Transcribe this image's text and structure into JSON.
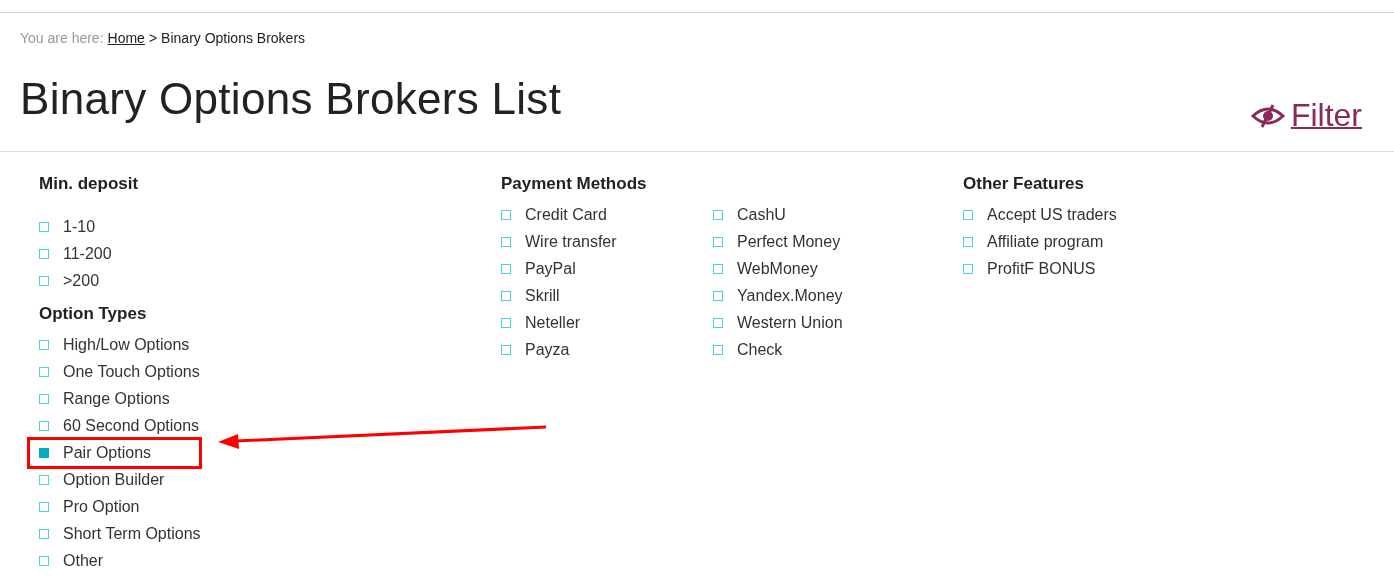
{
  "breadcrumb": {
    "prefix": "You are here:",
    "link": "Home",
    "separator": ">",
    "current": "Binary Options Brokers"
  },
  "title": "Binary Options Brokers List",
  "filter": {
    "label": "Filter"
  },
  "columns": [
    {
      "sections": [
        {
          "title": "Min. deposit",
          "item_columns": [
            [
              {
                "label": "1-10",
                "checked": false,
                "highlighted": false
              },
              {
                "label": "11-200",
                "checked": false,
                "highlighted": false
              },
              {
                "label": ">200",
                "checked": false,
                "highlighted": false
              }
            ]
          ]
        },
        {
          "title": "Option Types",
          "item_columns": [
            [
              {
                "label": "High/Low Options",
                "checked": false,
                "highlighted": false
              },
              {
                "label": "One Touch Options",
                "checked": false,
                "highlighted": false
              },
              {
                "label": "Range Options",
                "checked": false,
                "highlighted": false
              },
              {
                "label": "60 Second Options",
                "checked": false,
                "highlighted": false
              },
              {
                "label": "Pair Options",
                "checked": true,
                "highlighted": true
              },
              {
                "label": "Option Builder",
                "checked": false,
                "highlighted": false
              },
              {
                "label": "Pro Option",
                "checked": false,
                "highlighted": false
              },
              {
                "label": "Short Term Options",
                "checked": false,
                "highlighted": false
              },
              {
                "label": "Other",
                "checked": false,
                "highlighted": false
              }
            ]
          ]
        }
      ]
    },
    {
      "sections": [
        {
          "title": "Payment Methods",
          "item_columns": [
            [
              {
                "label": "Credit Card",
                "checked": false,
                "highlighted": false
              },
              {
                "label": "Wire transfer",
                "checked": false,
                "highlighted": false
              },
              {
                "label": "PayPal",
                "checked": false,
                "highlighted": false
              },
              {
                "label": "Skrill",
                "checked": false,
                "highlighted": false
              },
              {
                "label": "Neteller",
                "checked": false,
                "highlighted": false
              },
              {
                "label": "Payza",
                "checked": false,
                "highlighted": false
              }
            ],
            [
              {
                "label": "CashU",
                "checked": false,
                "highlighted": false
              },
              {
                "label": "Perfect Money",
                "checked": false,
                "highlighted": false
              },
              {
                "label": "WebMoney",
                "checked": false,
                "highlighted": false
              },
              {
                "label": "Yandex.Money",
                "checked": false,
                "highlighted": false
              },
              {
                "label": "Western Union",
                "checked": false,
                "highlighted": false
              },
              {
                "label": "Check",
                "checked": false,
                "highlighted": false
              }
            ]
          ]
        }
      ]
    },
    {
      "sections": [
        {
          "title": "Other Features",
          "item_columns": [
            [
              {
                "label": "Accept US traders",
                "checked": false,
                "highlighted": false
              },
              {
                "label": "Affiliate program",
                "checked": false,
                "highlighted": false
              },
              {
                "label": "ProfitF BONUS",
                "checked": false,
                "highlighted": false
              }
            ]
          ]
        }
      ]
    }
  ]
}
